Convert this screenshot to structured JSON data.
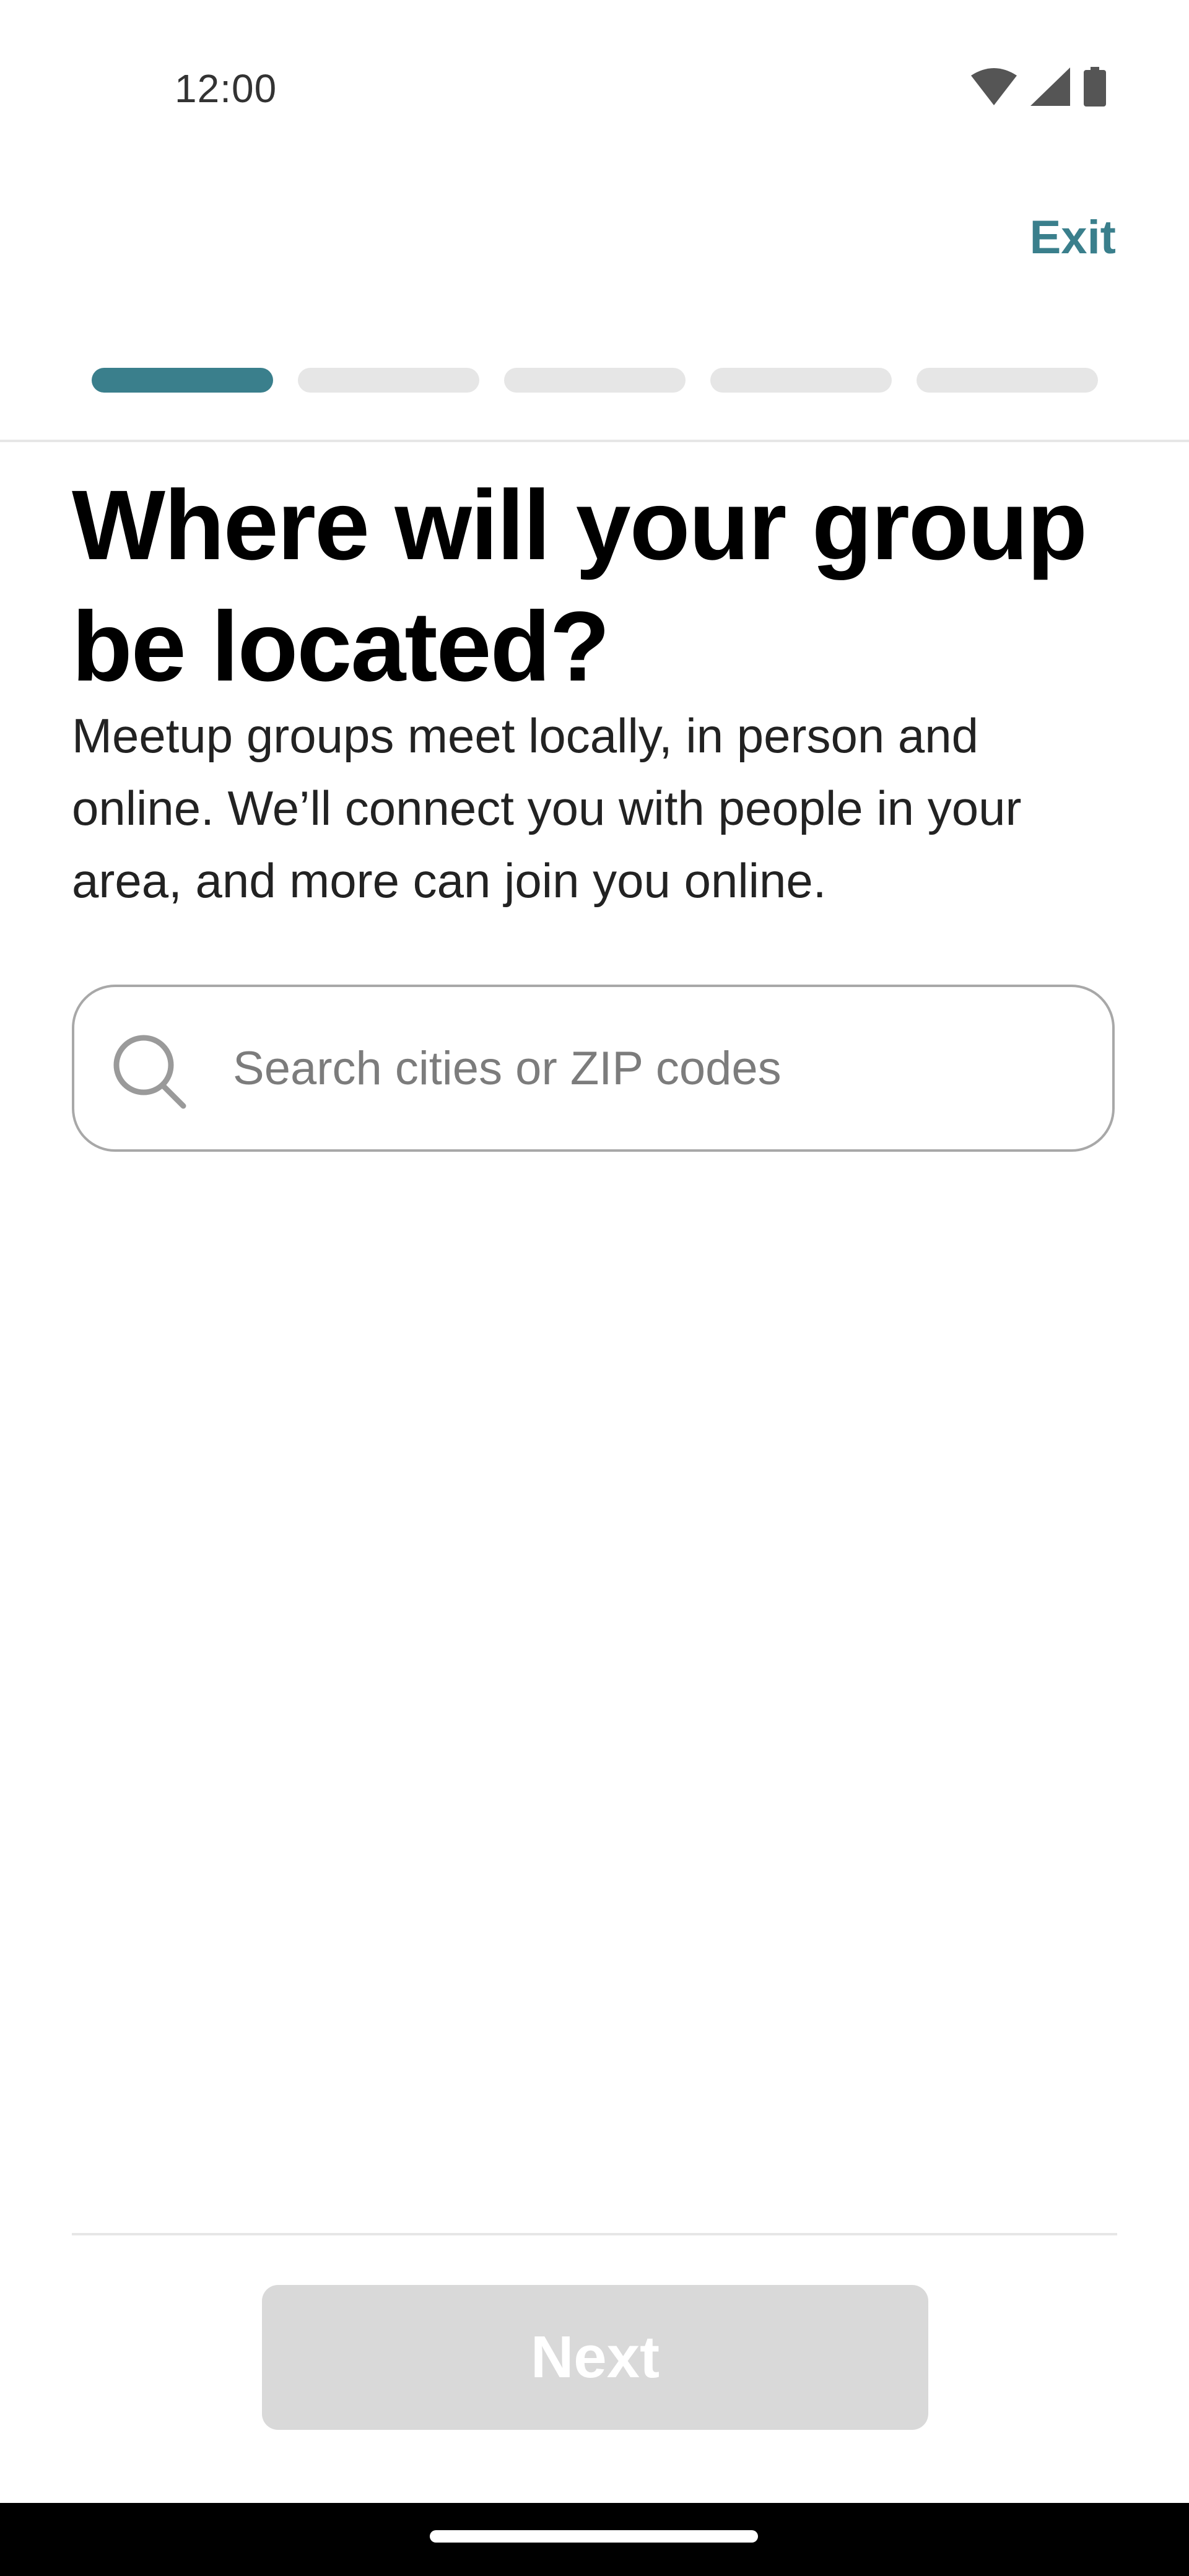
{
  "status_bar": {
    "time": "12:00",
    "icons": [
      "wifi-icon",
      "signal-icon",
      "battery-icon"
    ]
  },
  "header": {
    "exit_label": "Exit"
  },
  "progress": {
    "total_steps": 5,
    "current_step": 1,
    "active_color": "#3a7f8c",
    "inactive_color": "#e6e6e6"
  },
  "main": {
    "title": "Where will your group be located?",
    "description": "Meetup groups meet locally, in person and online. We’ll connect you with people in your area, and more can join you online.",
    "search": {
      "placeholder": "Search cities or ZIP codes",
      "value": "",
      "icon": "search-icon"
    }
  },
  "footer": {
    "next_label": "Next",
    "next_enabled": false
  },
  "colors": {
    "accent": "#3a7f8c",
    "disabled_button": "#d9d9d9"
  }
}
